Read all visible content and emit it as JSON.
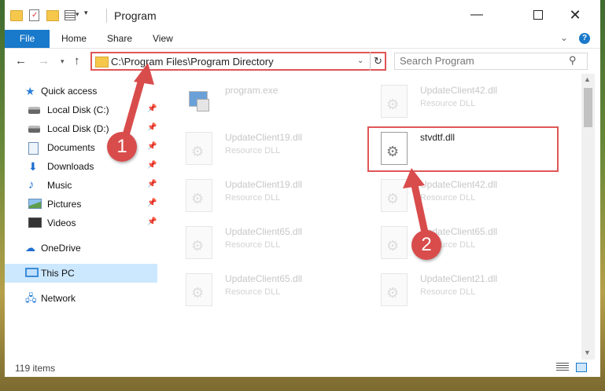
{
  "window": {
    "title": "Program",
    "controls": {
      "minimize": "—",
      "close": "✕"
    }
  },
  "ribbon": {
    "tabs": [
      "File",
      "Home",
      "Share",
      "View"
    ],
    "expand_glyph": "⌄",
    "help_glyph": "?"
  },
  "navigation": {
    "address": "C:\\Program Files\\Program Directory",
    "search_placeholder": "Search Program"
  },
  "sidebar": {
    "items": [
      {
        "label": "Quick access",
        "icon": "star-icon",
        "pinned": false
      },
      {
        "label": "Local Disk (C:)",
        "icon": "disk-icon",
        "pinned": true
      },
      {
        "label": "Local Disk (D:)",
        "icon": "disk-icon",
        "pinned": true
      },
      {
        "label": "Documents",
        "icon": "documents-icon",
        "pinned": true
      },
      {
        "label": "Downloads",
        "icon": "download-icon",
        "pinned": true
      },
      {
        "label": "Music",
        "icon": "music-icon",
        "pinned": true
      },
      {
        "label": "Pictures",
        "icon": "pictures-icon",
        "pinned": true
      },
      {
        "label": "Videos",
        "icon": "videos-icon",
        "pinned": true
      },
      {
        "label": "OneDrive",
        "icon": "cloud-icon",
        "pinned": false
      },
      {
        "label": "This PC",
        "icon": "computer-icon",
        "pinned": false,
        "selected": true
      },
      {
        "label": "Network",
        "icon": "network-icon",
        "pinned": false
      }
    ]
  },
  "files": [
    {
      "name": "program.exe",
      "type": ""
    },
    {
      "name": "UpdateClient42.dll",
      "type": "Resource DLL"
    },
    {
      "name": "UpdateClient19.dll",
      "type": "Resource DLL"
    },
    {
      "name": "stvdtf.dll",
      "type": "",
      "highlighted": true
    },
    {
      "name": "UpdateClient19.dll",
      "type": "Resource DLL"
    },
    {
      "name": "UpdateClient42.dll",
      "type": "Resource DLL"
    },
    {
      "name": "UpdateClient65.dll",
      "type": "Resource DLL"
    },
    {
      "name": "UpdateClient65.dll",
      "type": "Resource DLL"
    },
    {
      "name": "UpdateClient65.dll",
      "type": "Resource DLL"
    },
    {
      "name": "UpdateClient21.dll",
      "type": "Resource DLL"
    }
  ],
  "status": {
    "item_count": "119 items"
  },
  "annotations": {
    "step1": "1",
    "step2": "2",
    "color": "#d94c4c"
  }
}
